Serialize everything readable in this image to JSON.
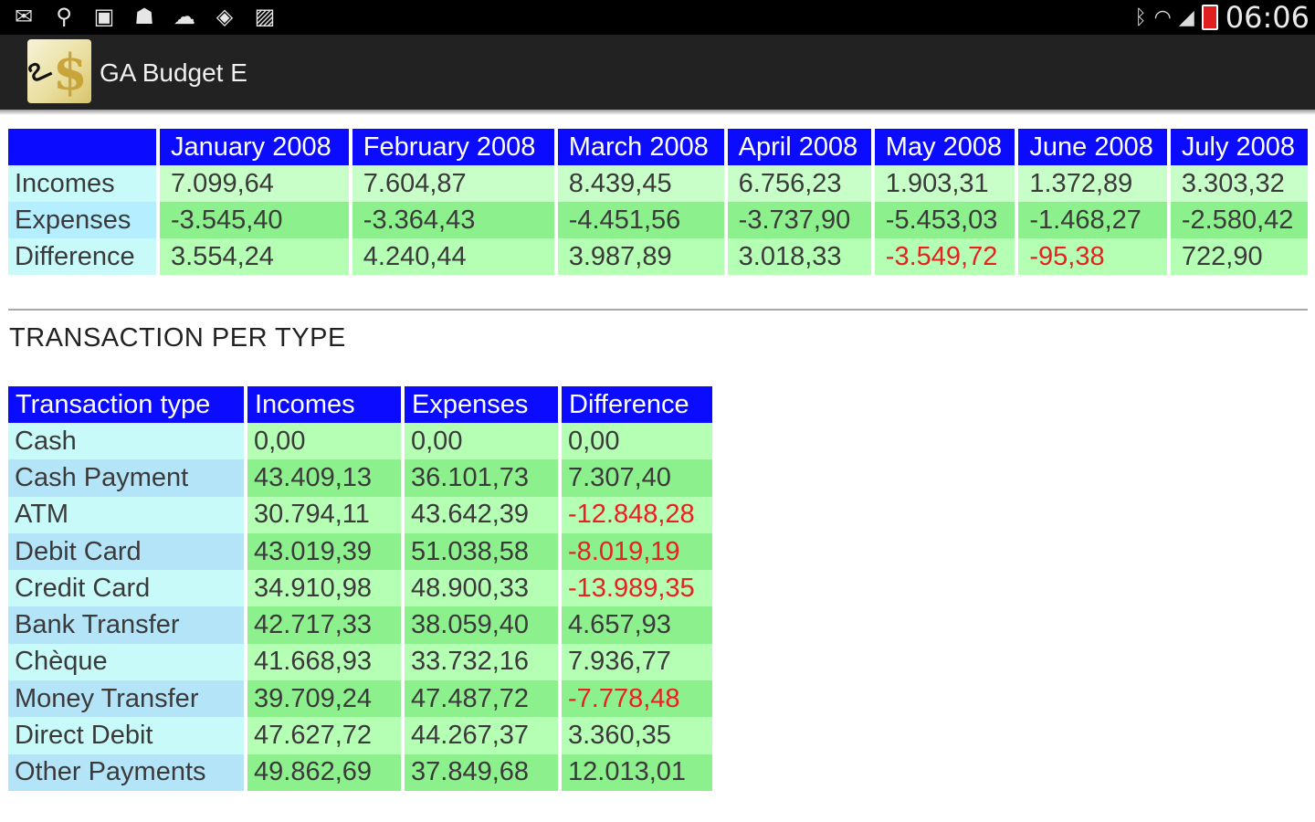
{
  "status_bar": {
    "left_icons": [
      "mail-icon",
      "usb-icon",
      "sd-card-icon",
      "android-icon",
      "cloud-upload-icon",
      "maps-icon",
      "image-icon"
    ],
    "time": "06:06"
  },
  "action_bar": {
    "app_title": "GA Budget E"
  },
  "monthly": {
    "columns": [
      "January 2008",
      "February 2008",
      "March 2008",
      "April 2008",
      "May 2008",
      "June 2008",
      "July 2008"
    ],
    "rows": [
      {
        "label": "Incomes",
        "values": [
          "7.099,64",
          "7.604,87",
          "8.439,45",
          "6.756,23",
          "1.903,31",
          "1.372,89",
          "3.303,32"
        ]
      },
      {
        "label": "Expenses",
        "values": [
          "-3.545,40",
          "-3.364,43",
          "-4.451,56",
          "-3.737,90",
          "-5.453,03",
          "-1.468,27",
          "-2.580,42"
        ]
      },
      {
        "label": "Difference",
        "values": [
          "3.554,24",
          "4.240,44",
          "3.987,89",
          "3.018,33",
          "-3.549,72",
          "-95,38",
          "722,90"
        ]
      }
    ]
  },
  "section_title": "TRANSACTION PER TYPE",
  "types": {
    "headers": [
      "Transaction type",
      "Incomes",
      "Expenses",
      "Difference"
    ],
    "rows": [
      {
        "type": "Cash",
        "incomes": "0,00",
        "expenses": "0,00",
        "difference": "0,00"
      },
      {
        "type": "Cash Payment",
        "incomes": "43.409,13",
        "expenses": "36.101,73",
        "difference": "7.307,40"
      },
      {
        "type": "ATM",
        "incomes": "30.794,11",
        "expenses": "43.642,39",
        "difference": "-12.848,28"
      },
      {
        "type": "Debit Card",
        "incomes": "43.019,39",
        "expenses": "51.038,58",
        "difference": "-8.019,19"
      },
      {
        "type": "Credit Card",
        "incomes": "34.910,98",
        "expenses": "48.900,33",
        "difference": "-13.989,35"
      },
      {
        "type": "Bank Transfer",
        "incomes": "42.717,33",
        "expenses": "38.059,40",
        "difference": "4.657,93"
      },
      {
        "type": "Chèque",
        "incomes": "41.668,93",
        "expenses": "33.732,16",
        "difference": "7.936,77"
      },
      {
        "type": "Money Transfer",
        "incomes": "39.709,24",
        "expenses": "47.487,72",
        "difference": "-7.778,48"
      },
      {
        "type": "Direct Debit",
        "incomes": "47.627,72",
        "expenses": "44.267,37",
        "difference": "3.360,35"
      },
      {
        "type": "Other Payments",
        "incomes": "49.862,69",
        "expenses": "37.849,68",
        "difference": "12.013,01"
      }
    ]
  },
  "colors": {
    "header_blue": "#0b0bff",
    "negative_red": "#e82020",
    "label_cyan": "#c8fafa",
    "value_green": "#b4ffb4"
  }
}
